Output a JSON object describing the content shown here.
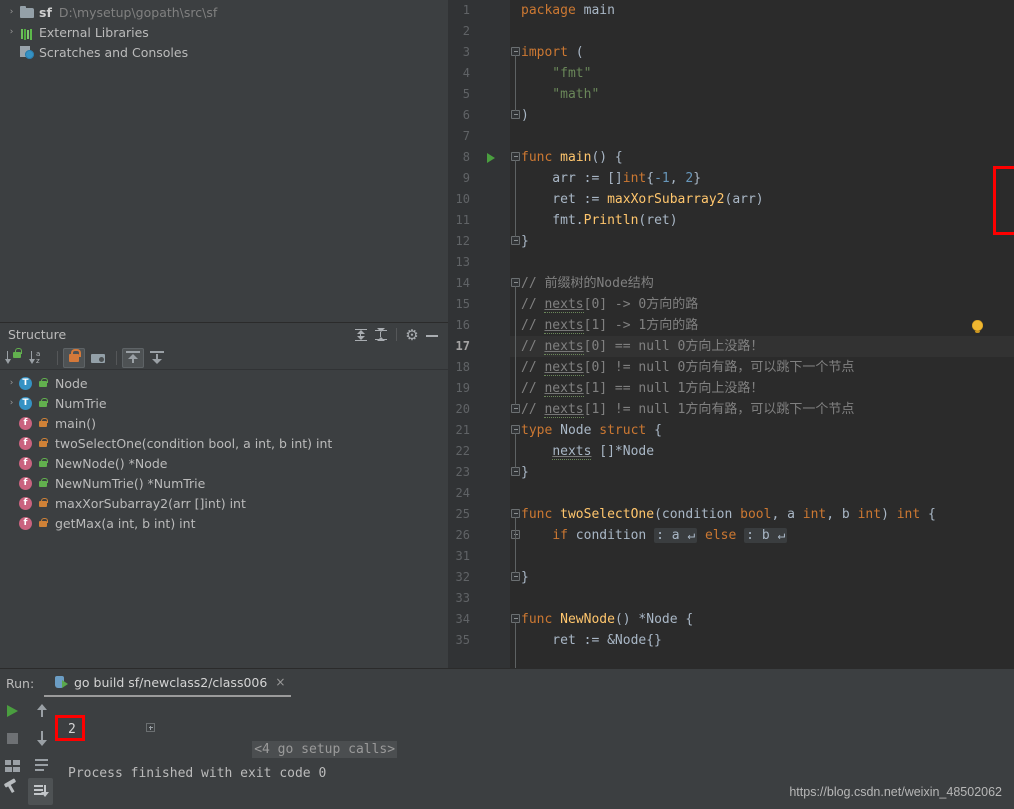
{
  "project_tree": [
    {
      "arrow": "›",
      "icon": "folder-icon",
      "name": "sf",
      "path": "D:\\mysetup\\gopath\\src\\sf",
      "bold": true
    },
    {
      "arrow": "›",
      "icon": "external-libraries-icon",
      "name": "External Libraries",
      "path": "",
      "bold": false
    },
    {
      "arrow": "",
      "icon": "scratches-icon",
      "name": "Scratches and Consoles",
      "path": "",
      "bold": false
    }
  ],
  "structure": {
    "title": "Structure",
    "header_buttons": [
      {
        "name": "expand-all-icon",
        "tooltip": "Expand All"
      },
      {
        "name": "collapse-all-icon",
        "tooltip": "Collapse All"
      },
      {
        "name": "gear-icon",
        "tooltip": "Settings"
      },
      {
        "name": "minimize-icon",
        "tooltip": "Hide"
      }
    ],
    "toolbar_buttons": [
      {
        "name": "sort-by-visibility-button",
        "active": false
      },
      {
        "name": "sort-alphabetically-button",
        "active": false
      },
      {
        "name": "show-non-public-button",
        "active": true
      },
      {
        "name": "group-by-file-button",
        "active": false
      },
      {
        "name": "scroll-from-source-button",
        "active": true
      },
      {
        "name": "scroll-to-source-button",
        "active": false
      }
    ],
    "items": [
      {
        "arrow": "›",
        "kind": "T",
        "lock": "green",
        "label": "Node"
      },
      {
        "arrow": "›",
        "kind": "T",
        "lock": "green",
        "label": "NumTrie"
      },
      {
        "arrow": "",
        "kind": "f",
        "lock": "orange",
        "label": "main()"
      },
      {
        "arrow": "",
        "kind": "f",
        "lock": "orange",
        "label": "twoSelectOne(condition bool, a int, b int) int"
      },
      {
        "arrow": "",
        "kind": "f",
        "lock": "green",
        "label": "NewNode() *Node"
      },
      {
        "arrow": "",
        "kind": "f",
        "lock": "green",
        "label": "NewNumTrie() *NumTrie"
      },
      {
        "arrow": "",
        "kind": "f",
        "lock": "orange",
        "label": "maxXorSubarray2(arr []int) int"
      },
      {
        "arrow": "",
        "kind": "f",
        "lock": "orange",
        "label": "getMax(a int, b int) int"
      }
    ]
  },
  "editor": {
    "current_line": 17,
    "run_marker_line": 8,
    "bulb_line": 16,
    "line_numbers": [
      1,
      2,
      3,
      4,
      5,
      6,
      7,
      8,
      9,
      10,
      11,
      12,
      13,
      14,
      15,
      16,
      17,
      18,
      19,
      20,
      21,
      22,
      23,
      24,
      25,
      26,
      31,
      32,
      33,
      34,
      35
    ],
    "lines": [
      {
        "n": 1,
        "text": "package main"
      },
      {
        "n": 2,
        "text": ""
      },
      {
        "n": 3,
        "text": "import ("
      },
      {
        "n": 4,
        "text": "    \"fmt\""
      },
      {
        "n": 5,
        "text": "    \"math\""
      },
      {
        "n": 6,
        "text": ")"
      },
      {
        "n": 7,
        "text": ""
      },
      {
        "n": 8,
        "text": "func main() {"
      },
      {
        "n": 9,
        "text": "    arr := []int{-1, 2}"
      },
      {
        "n": 10,
        "text": "    ret := maxXorSubarray2(arr)"
      },
      {
        "n": 11,
        "text": "    fmt.Println(ret)"
      },
      {
        "n": 12,
        "text": "}"
      },
      {
        "n": 13,
        "text": ""
      },
      {
        "n": 14,
        "text": "// 前缀树的Node结构"
      },
      {
        "n": 15,
        "text": "// nexts[0] -> 0方向的路"
      },
      {
        "n": 16,
        "text": "// nexts[1] -> 1方向的路"
      },
      {
        "n": 17,
        "text": "// nexts[0] == null 0方向上没路！"
      },
      {
        "n": 18,
        "text": "// nexts[0] != null 0方向有路，可以跳下一个节点"
      },
      {
        "n": 19,
        "text": "// nexts[1] == null 1方向上没路！"
      },
      {
        "n": 20,
        "text": "// nexts[1] != null 1方向有路，可以跳下一个节点"
      },
      {
        "n": 21,
        "text": "type Node struct {"
      },
      {
        "n": 22,
        "text": "    nexts []*Node"
      },
      {
        "n": 23,
        "text": "}"
      },
      {
        "n": 24,
        "text": ""
      },
      {
        "n": 25,
        "text": "func twoSelectOne(condition bool, a int, b int) int {"
      },
      {
        "n": 26,
        "text": "    if condition : a ↵ else : b ↵"
      },
      {
        "n": 31,
        "text": ""
      },
      {
        "n": 32,
        "text": "}"
      },
      {
        "n": 33,
        "text": ""
      },
      {
        "n": 34,
        "text": "func NewNode() *Node {"
      },
      {
        "n": 35,
        "text": "    ret := &Node{}"
      }
    ],
    "highlight_box": {
      "lines": "9-11",
      "color": "#ff0000"
    }
  },
  "run_panel": {
    "label": "Run:",
    "tab_label": "go build sf/newclass2/class006",
    "tab_close": "×",
    "left_buttons": [
      {
        "name": "rerun-button",
        "icon": "play-icon"
      },
      {
        "name": "stop-button",
        "icon": "stop-icon"
      },
      {
        "name": "layout-button",
        "icon": "layout-icon"
      },
      {
        "name": "pin-tab-button",
        "icon": "pin-icon"
      }
    ],
    "mid_buttons": [
      {
        "name": "up-the-stack-trace-button",
        "icon": "arrow-up-icon"
      },
      {
        "name": "down-the-stack-trace-button",
        "icon": "arrow-down-icon"
      },
      {
        "name": "soft-wrap-button",
        "icon": "soft-wrap-icon"
      },
      {
        "name": "scroll-to-end-button",
        "icon": "scroll-to-end-icon",
        "active": true
      }
    ],
    "console": {
      "setup_calls": "<4 go setup calls>",
      "output": "2",
      "finished": "Process finished with exit code 0"
    },
    "highlight_box": {
      "target": "output",
      "color": "#ff0000"
    }
  },
  "watermark": "https://blog.csdn.net/weixin_48502062"
}
